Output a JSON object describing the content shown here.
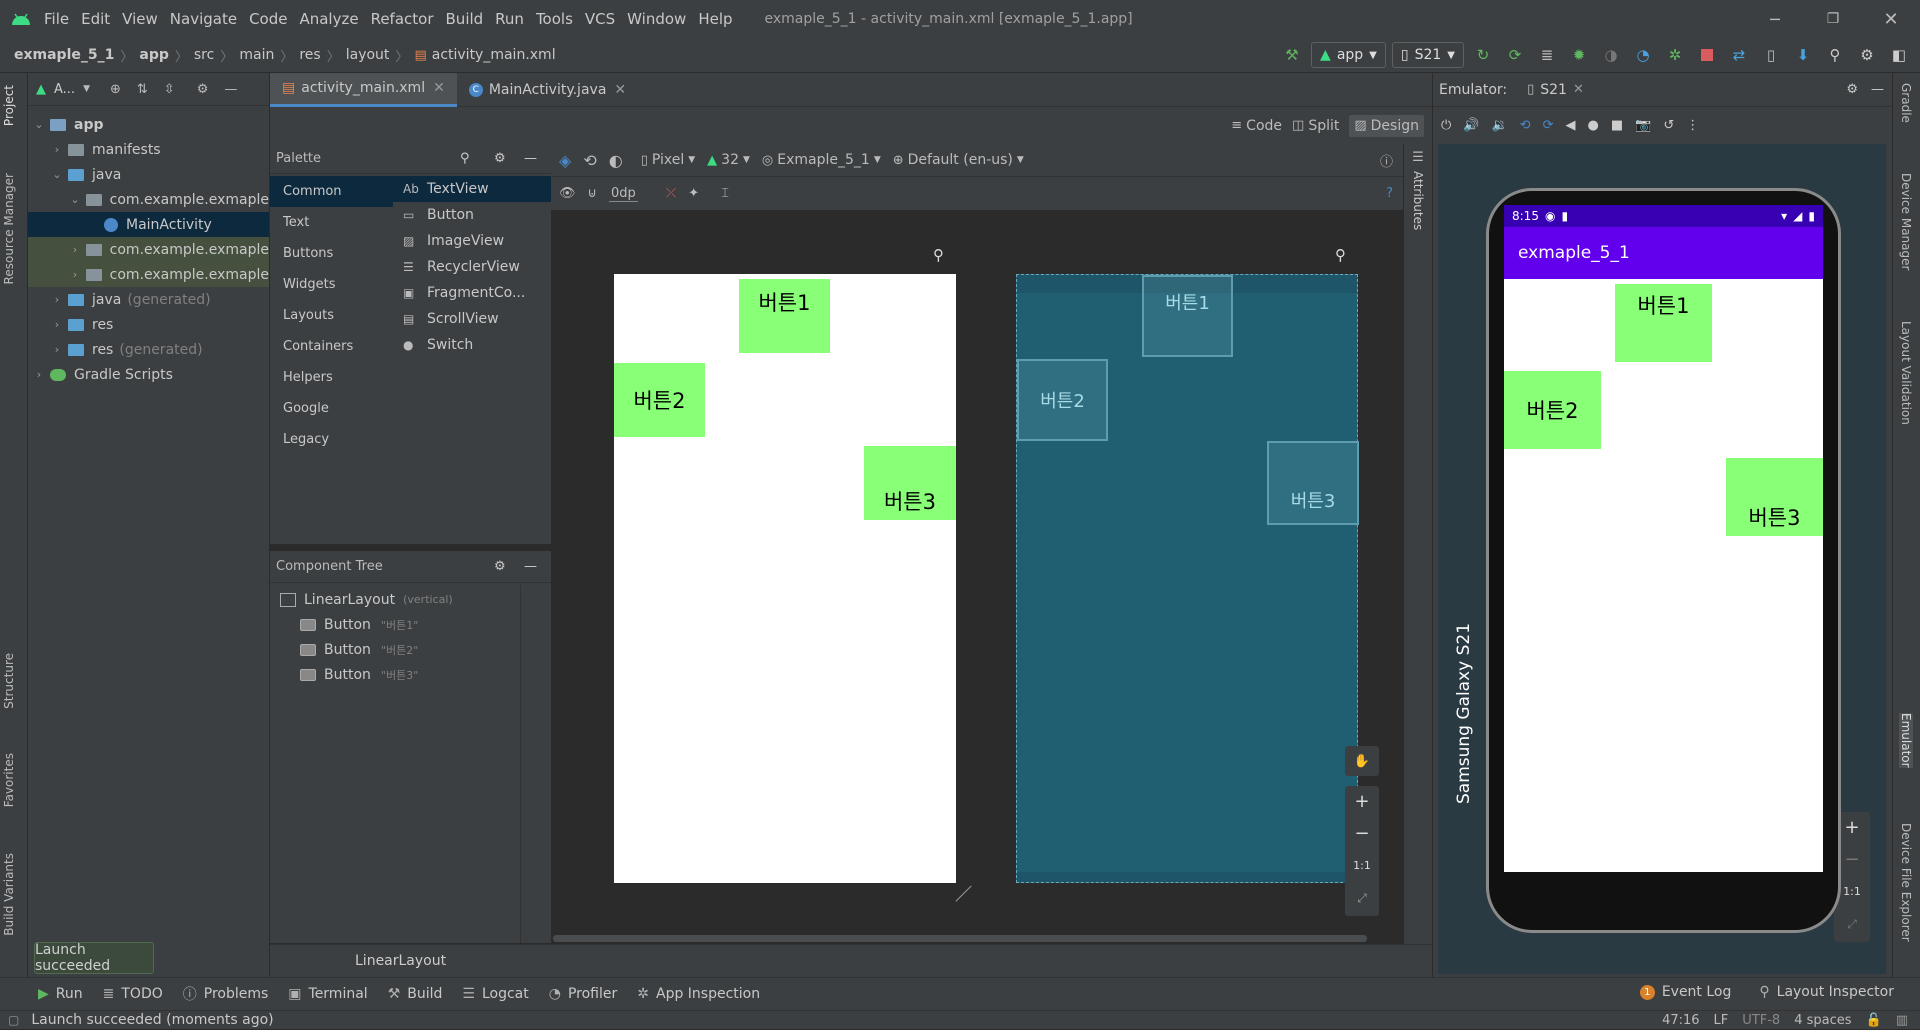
{
  "titlebar": {
    "menu": [
      "File",
      "Edit",
      "View",
      "Navigate",
      "Code",
      "Analyze",
      "Refactor",
      "Build",
      "Run",
      "Tools",
      "VCS",
      "Window",
      "Help"
    ],
    "window_title": "exmaple_5_1 - activity_main.xml [exmaple_5_1.app]"
  },
  "breadcrumb": [
    "exmaple_5_1",
    "app",
    "src",
    "main",
    "res",
    "layout",
    "activity_main.xml"
  ],
  "run_config": "app",
  "device": "S21",
  "project_panel": {
    "title": "A...",
    "items": [
      {
        "label": "app",
        "indent": 0,
        "open": true,
        "muted": ""
      },
      {
        "label": "manifests",
        "indent": 1,
        "open": false,
        "muted": ""
      },
      {
        "label": "java",
        "indent": 1,
        "open": true,
        "muted": ""
      },
      {
        "label": "com.example.exmaple",
        "indent": 2,
        "open": true,
        "muted": ""
      },
      {
        "label": "MainActivity",
        "indent": 3,
        "open": false,
        "muted": ""
      },
      {
        "label": "com.example.exmaple",
        "indent": 2,
        "open": false,
        "muted": ""
      },
      {
        "label": "com.example.exmaple",
        "indent": 2,
        "open": false,
        "muted": ""
      },
      {
        "label": "java",
        "indent": 1,
        "open": false,
        "muted": "(generated)"
      },
      {
        "label": "res",
        "indent": 1,
        "open": false,
        "muted": ""
      },
      {
        "label": "res",
        "indent": 1,
        "open": false,
        "muted": "(generated)"
      },
      {
        "label": "Gradle Scripts",
        "indent": 0,
        "open": false,
        "muted": ""
      }
    ]
  },
  "left_tabs": [
    "Project",
    "Resource Manager",
    "Structure",
    "Favorites",
    "Build Variants"
  ],
  "right_tabs": [
    "Gradle",
    "Device Manager",
    "Layout Validation",
    "Emulator",
    "Device File Explorer"
  ],
  "editor_tabs": [
    "activity_main.xml",
    "MainActivity.java"
  ],
  "view_modes": [
    "Code",
    "Split",
    "Design"
  ],
  "palette": {
    "title": "Palette",
    "categories": [
      "Common",
      "Text",
      "Buttons",
      "Widgets",
      "Layouts",
      "Containers",
      "Helpers",
      "Google",
      "Legacy"
    ],
    "items": [
      "TextView",
      "Button",
      "ImageView",
      "RecyclerView",
      "FragmentCo...",
      "ScrollView",
      "Switch"
    ]
  },
  "design_toolbar": {
    "device": "Pixel",
    "api": "32",
    "theme": "Exmaple_5_1",
    "locale": "Default (en-us)",
    "margin": "0dp"
  },
  "component_tree": {
    "title": "Component Tree",
    "root": "LinearLayout",
    "root_note": "(vertical)",
    "children": [
      {
        "type": "Button",
        "text": "\"버튼1\""
      },
      {
        "type": "Button",
        "text": "\"버튼2\""
      },
      {
        "type": "Button",
        "text": "\"버튼3\""
      }
    ]
  },
  "design_buttons": [
    "버튼1",
    "버튼2",
    "버튼3"
  ],
  "attributes_label": "Attributes",
  "zoom_controls": [
    "+",
    "−",
    "1:1"
  ],
  "bottom_path": "LinearLayout",
  "emulator": {
    "title": "Emulator:",
    "tab": "S21",
    "time": "8:15",
    "app_title": "exmaple_5_1",
    "buttons": [
      "버튼1",
      "버튼2",
      "버튼3"
    ],
    "device_label": "Samsung Galaxy S21",
    "colors": {
      "appbar": "#6200ee",
      "button": "#88ff77"
    }
  },
  "toast": "Launch succeeded",
  "bottom_tools": [
    "Run",
    "TODO",
    "Problems",
    "Terminal",
    "Build",
    "Logcat",
    "Profiler",
    "App Inspection"
  ],
  "bottom_right_tools": [
    "Event Log",
    "Layout Inspector"
  ],
  "event_count": "1",
  "status": {
    "message": "Launch succeeded (moments ago)",
    "position": "47:16",
    "line_sep": "LF",
    "encoding": "UTF-8",
    "indent": "4 spaces"
  }
}
